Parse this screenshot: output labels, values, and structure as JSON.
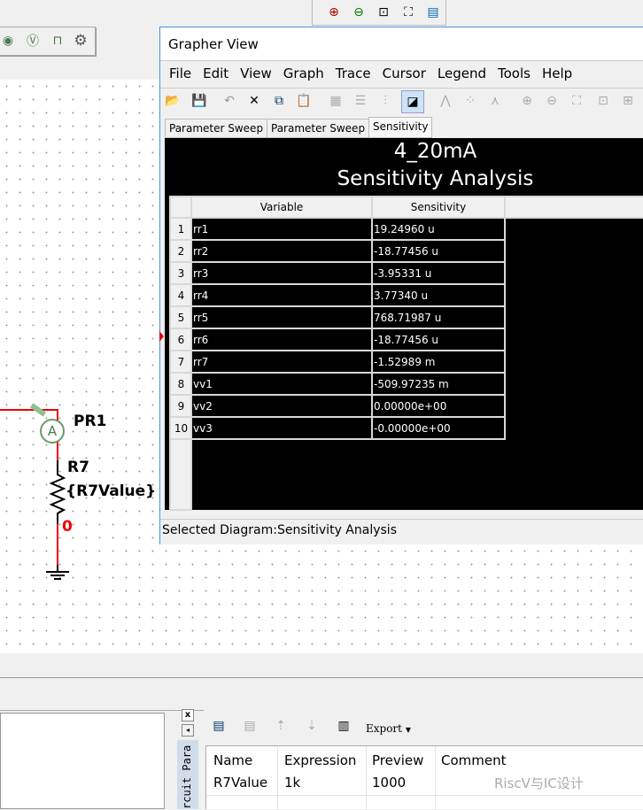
{
  "top_toolbar": {
    "icons": [
      "zoom-in-icon",
      "zoom-out-icon",
      "zoom-area-icon",
      "zoom-fit-icon",
      "grid-view-icon"
    ]
  },
  "left_toolbar": {
    "icons": [
      "ac-probe-icon",
      "voltage-probe-icon",
      "pulse-probe-icon",
      "gear-icon"
    ]
  },
  "schematic": {
    "probe_label": "PR1",
    "probe_symbol": "A",
    "resistor_name": "R7",
    "resistor_value": "{R7Value}",
    "node_label": "0",
    "wire_color": "#e00000"
  },
  "grapher": {
    "title": "Grapher View",
    "menu": [
      "File",
      "Edit",
      "View",
      "Graph",
      "Trace",
      "Cursor",
      "Legend",
      "Tools",
      "Help"
    ],
    "tabs": [
      "Parameter Sweep",
      "Parameter Sweep",
      "Sensitivity"
    ],
    "active_tab": "Sensitivity",
    "chart_title": "4_20mA",
    "chart_subtitle": "Sensitivity Analysis",
    "table": {
      "headers": [
        "Variable",
        "Sensitivity"
      ],
      "rows": [
        {
          "n": "1",
          "var": "rr1",
          "val": "19.24960 u"
        },
        {
          "n": "2",
          "var": "rr2",
          "val": "-18.77456 u"
        },
        {
          "n": "3",
          "var": "rr3",
          "val": "-3.95331 u"
        },
        {
          "n": "4",
          "var": "rr4",
          "val": "3.77340 u"
        },
        {
          "n": "5",
          "var": "rr5",
          "val": "768.71987 u"
        },
        {
          "n": "6",
          "var": "rr6",
          "val": "-18.77456 u"
        },
        {
          "n": "7",
          "var": "rr7",
          "val": "-1.52989 m"
        },
        {
          "n": "8",
          "var": "vv1",
          "val": "-509.97235 m"
        },
        {
          "n": "9",
          "var": "vv2",
          "val": "0.00000e+00"
        },
        {
          "n": "10",
          "var": "vv3",
          "val": "-0.00000e+00"
        }
      ]
    },
    "status": "Selected Diagram:Sensitivity Analysis"
  },
  "bottom": {
    "dock_label": "rcuit Para",
    "close": "x",
    "export_label": "Export",
    "table": {
      "headers": [
        "Name",
        "Expression",
        "Preview",
        "Comment"
      ],
      "rows": [
        {
          "name": "R7Value",
          "expression": "1k",
          "preview": "1000",
          "comment": ""
        }
      ]
    },
    "watermark": "RiscV与IC设计"
  }
}
